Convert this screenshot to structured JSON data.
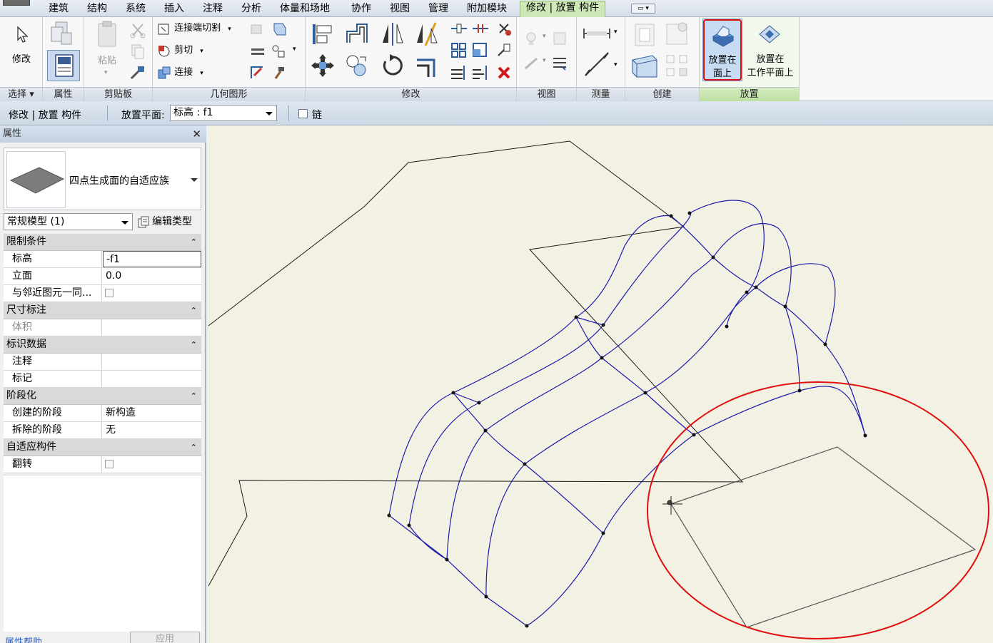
{
  "menubar": {
    "tabs": [
      "建筑",
      "结构",
      "系统",
      "插入",
      "注释",
      "分析",
      "体量和场地",
      "协作",
      "视图",
      "管理",
      "附加模块"
    ],
    "active_tab": "修改 | 放置 构件"
  },
  "ribbon": {
    "select": {
      "modify_label": "修改",
      "title": "选择"
    },
    "properties": {
      "title": "属性"
    },
    "clipboard": {
      "paste_label": "粘贴",
      "title": "剪贴板"
    },
    "geometry": {
      "join_cut_label": "连接端切割",
      "cut_label": "剪切",
      "join_label": "连接",
      "title": "几何图形"
    },
    "modify": {
      "title": "修改"
    },
    "view": {
      "title": "视图"
    },
    "measure": {
      "title": "测量"
    },
    "create": {
      "title": "创建"
    },
    "place": {
      "on_face_label_1": "放置在",
      "on_face_label_2": "面上",
      "on_workplane_label_1": "放置在",
      "on_workplane_label_2": "工作平面上",
      "title": "放置"
    }
  },
  "options_bar": {
    "context_label": "修改 | 放置 构件",
    "placement_plane_label": "放置平面:",
    "placement_plane_value": "标高 : f1",
    "chain_label": "链",
    "chain_checked": false
  },
  "properties": {
    "title": "属性",
    "close_glyph": "✕",
    "type_name": "四点生成面的自适应族",
    "filter_value": "常规模型 (1)",
    "edit_type_label": "编辑类型",
    "groups": [
      {
        "name": "限制条件",
        "rows": [
          {
            "key": "标高",
            "value": "-f1",
            "kind": "edit"
          },
          {
            "key": "立面",
            "value": "0.0",
            "kind": "text"
          },
          {
            "key": "与邻近图元一同...",
            "value": "",
            "kind": "check"
          }
        ]
      },
      {
        "name": "尺寸标注",
        "rows": [
          {
            "key": "体积",
            "value": "",
            "kind": "disabled"
          }
        ]
      },
      {
        "name": "标识数据",
        "rows": [
          {
            "key": "注释",
            "value": "",
            "kind": "text"
          },
          {
            "key": "标记",
            "value": "",
            "kind": "text"
          }
        ]
      },
      {
        "name": "阶段化",
        "rows": [
          {
            "key": "创建的阶段",
            "value": "新构造",
            "kind": "text"
          },
          {
            "key": "拆除的阶段",
            "value": "无",
            "kind": "text"
          }
        ]
      },
      {
        "name": "自适应构件",
        "rows": [
          {
            "key": "翻转",
            "value": "",
            "kind": "check"
          }
        ]
      }
    ],
    "help_link": "属性帮助",
    "apply_label": "应用"
  },
  "colors": {
    "canvas_bg": "#f3f1e4",
    "curve_blue": "#1c1ca8",
    "highlight_red": "#e01010",
    "active_tab_green": "#cfe8b8"
  }
}
